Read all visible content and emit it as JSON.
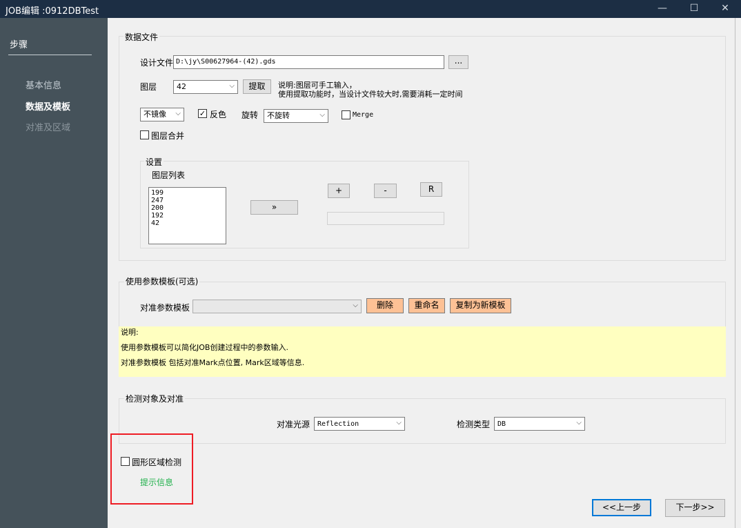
{
  "window": {
    "title": "JOB编辑 :0912DBTest",
    "minimize": "—",
    "maximize": "☐",
    "close": "✕"
  },
  "sidebar": {
    "header": "步骤",
    "items": [
      {
        "label": "基本信息",
        "state": "done"
      },
      {
        "label": "数据及模板",
        "state": "active"
      },
      {
        "label": "对准及区域",
        "state": "todo"
      }
    ]
  },
  "data_file": {
    "group_label": "数据文件",
    "design_file_label": "设计文件",
    "design_file_value": "D:\\jy\\S00627964-(42).gds",
    "browse_label": "...",
    "layer_label": "图层",
    "layer_value": "42",
    "extract_label": "提取",
    "note_line1": "说明:图层可手工输入，",
    "note_line2": "使用提取功能时，当设计文件较大时,需要消耗一定时间",
    "mirror_value": "不镜像",
    "invert_label": "反色",
    "invert_checked": true,
    "rotate_label": "旋转",
    "rotate_value": "不旋转",
    "merge_label": "Merge",
    "merge_checked": false,
    "layer_merge_label": "图层合并",
    "layer_merge_checked": false
  },
  "settings": {
    "group_label": "设置",
    "layer_list_label": "图层列表",
    "layers": [
      "199",
      "247",
      "200",
      "192",
      "42"
    ],
    "transfer_label": "»",
    "plus_label": "+",
    "minus_label": "-",
    "r_label": "R"
  },
  "template": {
    "group_label": "使用参数模板(可选)",
    "align_template_label": "对准参数模板",
    "align_template_value": "",
    "delete_label": "删除",
    "rename_label": "重命名",
    "copy_label": "复制为新模板"
  },
  "note": {
    "line1": "说明:",
    "line2": "使用参数模板可以简化JOB创建过程中的参数输入.",
    "line3": "对准参数模板  包括对准Mark点位置, Mark区域等信息."
  },
  "detect": {
    "group_label": "检测对象及对准",
    "light_label": "对准光源",
    "light_value": "Reflection",
    "type_label": "检测类型",
    "type_value": "DB"
  },
  "circle": {
    "label": "圆形区域检测",
    "checked": false,
    "hint": "提示信息"
  },
  "nav": {
    "prev_label": "<<上一步",
    "next_label": "下一步>>"
  }
}
